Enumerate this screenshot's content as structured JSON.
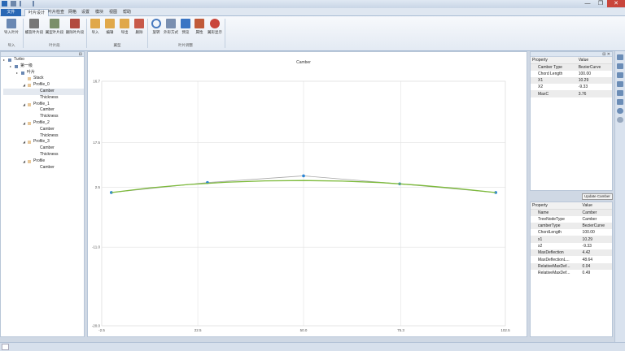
{
  "tabs": [
    "文件",
    "叶片设计",
    "叶片检查",
    "网格",
    "设置",
    "模块",
    "视图",
    "帮助"
  ],
  "ribbon": {
    "buttons": [
      {
        "label": "导入叶片",
        "color": "#6a88b3"
      },
      {
        "label": "螺旋叶片段",
        "color": "#777777"
      },
      {
        "label": "翼型叶片段",
        "color": "#7a8f6a"
      },
      {
        "label": "删除叶片段",
        "color": "#b24a3f"
      },
      {
        "label": "导入",
        "color": "#e0a84a"
      },
      {
        "label": "编辑",
        "color": "#e0a84a"
      },
      {
        "label": "导出",
        "color": "#e0a84a"
      },
      {
        "label": "删除",
        "color": "#c85a4a"
      },
      {
        "label": "旋转",
        "color": "#4a7bbf"
      },
      {
        "label": "外形方式",
        "color": "#7a8fb0"
      },
      {
        "label": "预览",
        "color": "#3a75c4"
      },
      {
        "label": "属性",
        "color": "#c05a3a"
      },
      {
        "label": "翼形显示",
        "color": "#c9453b"
      }
    ],
    "groups": [
      "导入",
      "叶片段",
      "翼型",
      "叶片调整"
    ]
  },
  "tree": [
    {
      "label": "Turbo",
      "indent": 0,
      "twist": "▸"
    },
    {
      "label": "第一级",
      "indent": 1,
      "twist": "▸"
    },
    {
      "label": "叶片",
      "indent": 2,
      "twist": "▸"
    },
    {
      "label": "Stack",
      "indent": 3,
      "twist": ""
    },
    {
      "label": "Profile_0",
      "indent": 3,
      "twist": "◢"
    },
    {
      "label": "Camber",
      "indent": 4,
      "twist": "",
      "selected": true
    },
    {
      "label": "Thickness",
      "indent": 4,
      "twist": ""
    },
    {
      "label": "Profile_1",
      "indent": 3,
      "twist": "◢"
    },
    {
      "label": "Camber",
      "indent": 4,
      "twist": ""
    },
    {
      "label": "Thickness",
      "indent": 4,
      "twist": ""
    },
    {
      "label": "Profile_2",
      "indent": 3,
      "twist": "◢"
    },
    {
      "label": "Camber",
      "indent": 4,
      "twist": ""
    },
    {
      "label": "Thickness",
      "indent": 4,
      "twist": ""
    },
    {
      "label": "Profile_3",
      "indent": 3,
      "twist": "◢"
    },
    {
      "label": "Camber",
      "indent": 4,
      "twist": ""
    },
    {
      "label": "Thickness",
      "indent": 4,
      "twist": ""
    },
    {
      "label": "Profile",
      "indent": 3,
      "twist": "◢"
    },
    {
      "label": "Camber",
      "indent": 4,
      "twist": ""
    }
  ],
  "chart_data": {
    "type": "line",
    "title": "Camber",
    "xlim": [
      -2.5,
      102.5
    ],
    "ylim": [
      -20.0,
      16.7
    ],
    "xticks": [
      "-2.5",
      "22.5",
      "50.0",
      "75.3",
      "102.5"
    ],
    "xtick_values": [
      -2.5,
      22.5,
      50.0,
      75.3,
      102.5
    ],
    "yticks": [
      "16.7",
      "17.5",
      "2.5",
      "-11.0",
      "-20.0"
    ],
    "ytick_values": [
      16.7,
      7.5,
      0.8,
      -8.2,
      -20.0
    ],
    "grid": true,
    "series": [
      {
        "name": "",
        "color": "#a8a8a8",
        "style": "control-polygon",
        "x": [
          0,
          25,
          50,
          75,
          100
        ],
        "y": [
          0,
          1.5,
          2.5,
          1.3,
          0
        ],
        "markers": true
      },
      {
        "name": "",
        "color": "#7cba3a",
        "style": "curve",
        "x": [
          0,
          10,
          20,
          30,
          40,
          50,
          60,
          70,
          80,
          90,
          100
        ],
        "y": [
          0,
          0.7,
          1.2,
          1.55,
          1.75,
          1.8,
          1.72,
          1.5,
          1.1,
          0.6,
          0
        ]
      }
    ],
    "marker_color": "#2b86d6"
  },
  "props_top": {
    "headers": [
      "Property",
      "Value"
    ],
    "rows": [
      [
        "Camber Type",
        "BezierCurve"
      ],
      [
        "Chord Length",
        "100.00"
      ],
      [
        "X1",
        "10.29"
      ],
      [
        "X2",
        "-9.33"
      ],
      [
        "MaxC",
        "3.76"
      ]
    ]
  },
  "update_button": "Update Camber",
  "props_bottom": {
    "headers": [
      "Property",
      "Value"
    ],
    "rows": [
      [
        "Name",
        "Camber"
      ],
      [
        "TreeNodeType",
        "Camber"
      ],
      [
        "camberType",
        "BezierCurve"
      ],
      [
        "ChordLength",
        "100.00"
      ],
      [
        "x1",
        "10.29"
      ],
      [
        "x2",
        "-9.33"
      ],
      [
        "MaxDeflection",
        "4.42"
      ],
      [
        "MaxDeflectionL...",
        "48.64"
      ],
      [
        "RelativeMaxDef...",
        "0.04"
      ],
      [
        "RelativeMaxDef...",
        "0.49"
      ]
    ]
  },
  "window_buttons": [
    "—",
    "❐",
    "✕"
  ]
}
